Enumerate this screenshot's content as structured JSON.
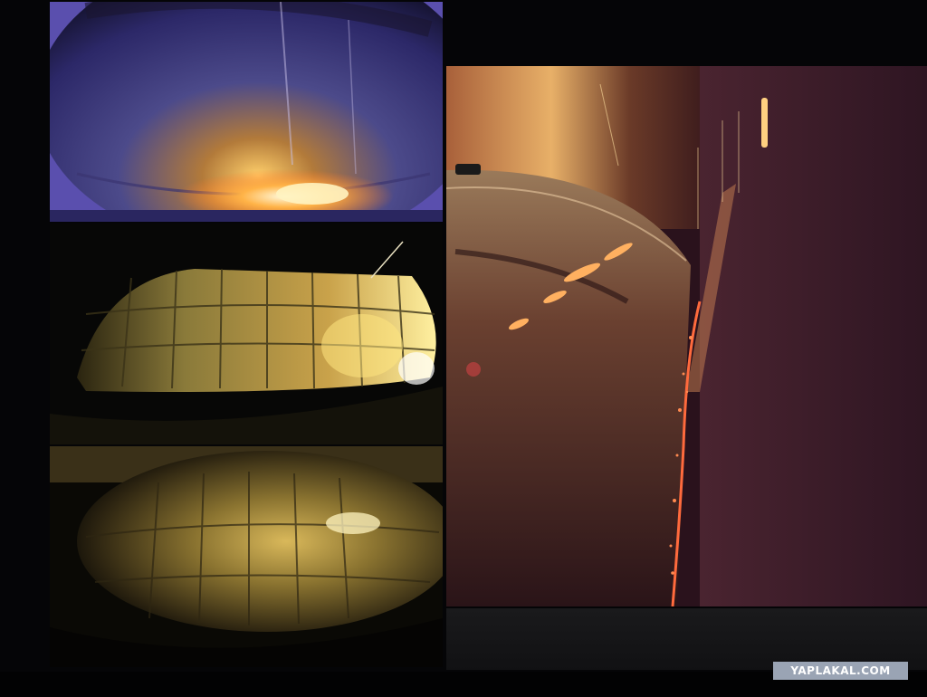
{
  "watermark": {
    "text": "YAPLAKAL.COM"
  },
  "colors": {
    "background": "#050507",
    "fire": "#ffb347",
    "spark": "#ff6a3d",
    "tile_gold": "#c9a24a",
    "dome_purple": "#5a4fae"
  }
}
